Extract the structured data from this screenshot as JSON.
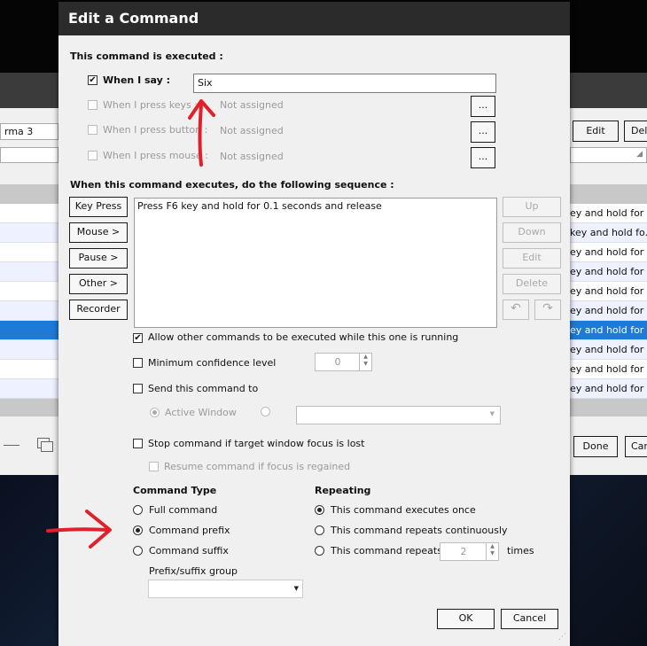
{
  "background_window": {
    "field_text": "rma 3",
    "edit_label": "Edit",
    "delete_label": "Del",
    "done_label": "Done",
    "cancel_label": "Car",
    "row_texts": [
      "ey and hold for ...",
      "key and hold fo...",
      "ey and hold for ...",
      "ey and hold for ...",
      "ey and hold for ...",
      "ey and hold for ...",
      "ey and hold for ...",
      "ey and hold for ...",
      "ey and hold for ...",
      "ey and hold for ..."
    ],
    "selected_row_index": 6
  },
  "dialog": {
    "title": "Edit a Command",
    "executed_heading": "This command is executed :",
    "when_i_say": {
      "label": "When I say :",
      "checked": true,
      "value": "Six"
    },
    "press_keys": {
      "label": "When I press keys :",
      "value": "Not assigned",
      "browse": "..."
    },
    "press_button": {
      "label": "When I press button :",
      "value": "Not assigned",
      "browse": "..."
    },
    "press_mouse": {
      "label": "When I press mouse :",
      "value": "Not assigned",
      "browse": "..."
    },
    "sequence_heading": "When this command executes, do the following sequence :",
    "left_buttons": [
      "Key Press",
      "Mouse >",
      "Pause >",
      "Other >",
      "Recorder"
    ],
    "sequence_items": [
      "Press F6 key and hold for 0.1 seconds and release"
    ],
    "right_buttons": [
      "Up",
      "Down",
      "Edit",
      "Delete"
    ],
    "allow_other": {
      "label": "Allow other commands to be executed while this one is running",
      "checked": true
    },
    "min_confidence": {
      "label": "Minimum confidence level",
      "checked": false,
      "value": "0"
    },
    "send_to": {
      "label": "Send this command to",
      "checked": false,
      "active_window_label": "Active Window"
    },
    "stop_on_focus_lost": {
      "label": "Stop command if target window focus is lost",
      "checked": false
    },
    "resume_on_focus": {
      "label": "Resume command if focus is regained",
      "checked": false
    },
    "command_type": {
      "heading": "Command Type",
      "options": [
        "Full command",
        "Command prefix",
        "Command suffix"
      ],
      "selected": "Command prefix",
      "group_label": "Prefix/suffix group"
    },
    "repeating": {
      "heading": "Repeating",
      "options": [
        "This command executes once",
        "This command repeats continuously",
        "This command repeats"
      ],
      "selected": "This command executes once",
      "repeat_count": "2",
      "times_label": "times"
    },
    "ok_label": "OK",
    "cancel_label": "Cancel"
  },
  "annotations": {
    "color": "#e0202a"
  }
}
